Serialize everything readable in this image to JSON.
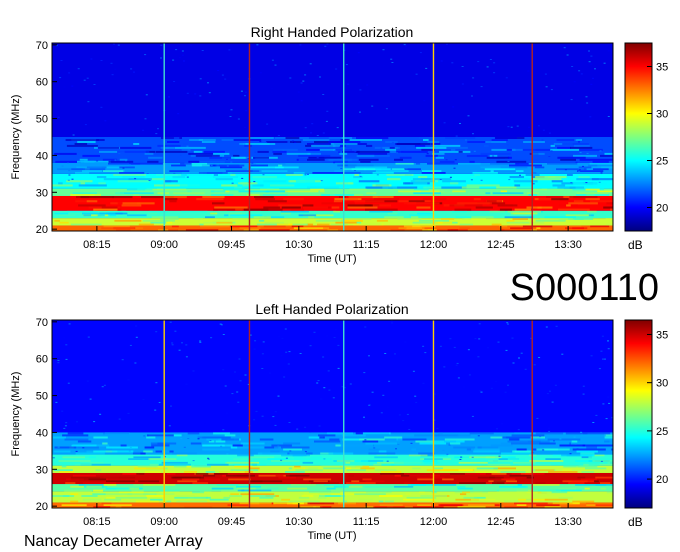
{
  "figure_id": "S000110",
  "footer": "Nancay Decameter Array",
  "colormap": [
    "#00007f",
    "#0000ff",
    "#007fff",
    "#00ffff",
    "#7fff7f",
    "#ffff00",
    "#ff7f00",
    "#ff0000",
    "#7f0000"
  ],
  "chart_data": [
    {
      "type": "heatmap",
      "title": "Right Handed Polarization",
      "xlabel": "Time (UT)",
      "ylabel": "Frequency (MHz)",
      "colorbar_label": "dB",
      "x_ticks": [
        "08:15",
        "09:00",
        "09:45",
        "10:30",
        "11:15",
        "12:00",
        "12:45",
        "13:30"
      ],
      "y_ticks": [
        20,
        30,
        40,
        50,
        60,
        70
      ],
      "ylim": [
        19.5,
        70.5
      ],
      "colorbar_ticks": [
        20,
        25,
        30,
        35
      ],
      "colorbar_range": [
        17.5,
        37.5
      ],
      "time_range": [
        "07:45",
        "14:00"
      ],
      "background_db": 19.5,
      "bands": [
        {
          "f0": 19.5,
          "f1": 21,
          "db": 33
        },
        {
          "f0": 21,
          "f1": 23,
          "db": 29
        },
        {
          "f0": 23,
          "f1": 25,
          "db": 26
        },
        {
          "f0": 25,
          "f1": 29,
          "db": 35
        },
        {
          "f0": 29,
          "f1": 31,
          "db": 27
        },
        {
          "f0": 31,
          "f1": 35,
          "db": 25
        },
        {
          "f0": 35,
          "f1": 38,
          "db": 23
        },
        {
          "f0": 38,
          "f1": 45,
          "db": 21.5
        }
      ],
      "vertical_lines": [
        {
          "t": "09:00",
          "color": "#40e0d0"
        },
        {
          "t": "09:57",
          "color": "#b22222"
        },
        {
          "t": "11:00",
          "color": "#40e0d0"
        },
        {
          "t": "12:00",
          "color": "#ffd000"
        },
        {
          "t": "13:06",
          "color": "#b22222"
        }
      ]
    },
    {
      "type": "heatmap",
      "title": "Left Handed Polarization",
      "xlabel": "Time (UT)",
      "ylabel": "Frequency (MHz)",
      "colorbar_label": "dB",
      "x_ticks": [
        "08:15",
        "09:00",
        "09:45",
        "10:30",
        "11:15",
        "12:00",
        "12:45",
        "13:30"
      ],
      "y_ticks": [
        20,
        30,
        40,
        50,
        60,
        70
      ],
      "ylim": [
        19.5,
        70.5
      ],
      "colorbar_ticks": [
        20,
        25,
        30,
        35
      ],
      "colorbar_range": [
        17,
        36.5
      ],
      "time_range": [
        "07:45",
        "14:00"
      ],
      "background_db": 19.5,
      "bands": [
        {
          "f0": 19.5,
          "f1": 21,
          "db": 32
        },
        {
          "f0": 21,
          "f1": 24,
          "db": 28
        },
        {
          "f0": 24,
          "f1": 26,
          "db": 26
        },
        {
          "f0": 26,
          "f1": 29,
          "db": 35
        },
        {
          "f0": 29,
          "f1": 31,
          "db": 28
        },
        {
          "f0": 31,
          "f1": 34,
          "db": 25
        },
        {
          "f0": 34,
          "f1": 40,
          "db": 22.5
        }
      ],
      "vertical_lines": [
        {
          "t": "09:00",
          "color": "#ffd000"
        },
        {
          "t": "09:57",
          "color": "#b22222"
        },
        {
          "t": "11:00",
          "color": "#40e0d0"
        },
        {
          "t": "12:00",
          "color": "#ffd000"
        },
        {
          "t": "13:06",
          "color": "#b22222"
        }
      ]
    }
  ]
}
